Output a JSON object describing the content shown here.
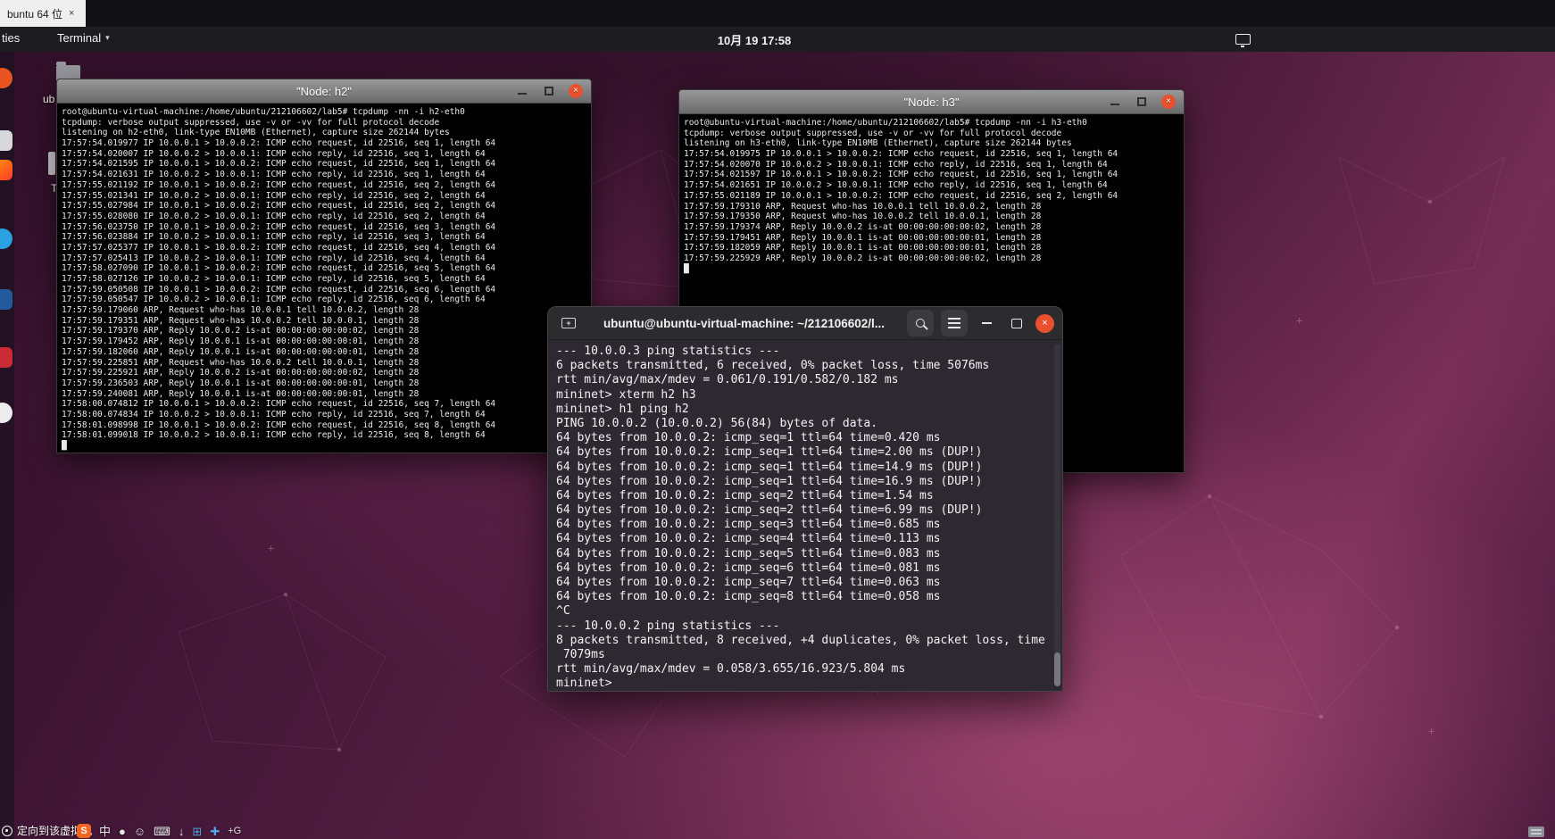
{
  "colors": {
    "accent-close": "#e8502f",
    "sogou-orange": "#f26522",
    "gterm-bg": "#2e2830",
    "ubuntu-orange": "#e95420"
  },
  "icons": {
    "close_x": "×",
    "caret_down": "▾",
    "plus": "+"
  },
  "vmware": {
    "tab_title": "buntu 64 位",
    "statusbar_hint": "定向到该虚拟机"
  },
  "topbar": {
    "activities_fragment": "ties",
    "app_menu": "Terminal",
    "clock": "10月 19 17:58"
  },
  "desktop": {
    "icon_label_fragment_1": "ub",
    "icon_label_fragment_2": "T"
  },
  "h2": {
    "title": "\"Node: h2\"",
    "lines": [
      "root@ubuntu-virtual-machine:/home/ubuntu/212106602/lab5# tcpdump -nn -i h2-eth0",
      "tcpdump: verbose output suppressed, use -v or -vv for full protocol decode",
      "listening on h2-eth0, link-type EN10MB (Ethernet), capture size 262144 bytes",
      "17:57:54.019977 IP 10.0.0.1 > 10.0.0.2: ICMP echo request, id 22516, seq 1, length 64",
      "17:57:54.020007 IP 10.0.0.2 > 10.0.0.1: ICMP echo reply, id 22516, seq 1, length 64",
      "17:57:54.021595 IP 10.0.0.1 > 10.0.0.2: ICMP echo request, id 22516, seq 1, length 64",
      "17:57:54.021631 IP 10.0.0.2 > 10.0.0.1: ICMP echo reply, id 22516, seq 1, length 64",
      "17:57:55.021192 IP 10.0.0.1 > 10.0.0.2: ICMP echo request, id 22516, seq 2, length 64",
      "17:57:55.021341 IP 10.0.0.2 > 10.0.0.1: ICMP echo reply, id 22516, seq 2, length 64",
      "17:57:55.027984 IP 10.0.0.1 > 10.0.0.2: ICMP echo request, id 22516, seq 2, length 64",
      "17:57:55.028080 IP 10.0.0.2 > 10.0.0.1: ICMP echo reply, id 22516, seq 2, length 64",
      "17:57:56.023750 IP 10.0.0.1 > 10.0.0.2: ICMP echo request, id 22516, seq 3, length 64",
      "17:57:56.023884 IP 10.0.0.2 > 10.0.0.1: ICMP echo reply, id 22516, seq 3, length 64",
      "17:57:57.025377 IP 10.0.0.1 > 10.0.0.2: ICMP echo request, id 22516, seq 4, length 64",
      "17:57:57.025413 IP 10.0.0.2 > 10.0.0.1: ICMP echo reply, id 22516, seq 4, length 64",
      "17:57:58.027090 IP 10.0.0.1 > 10.0.0.2: ICMP echo request, id 22516, seq 5, length 64",
      "17:57:58.027126 IP 10.0.0.2 > 10.0.0.1: ICMP echo reply, id 22516, seq 5, length 64",
      "17:57:59.050508 IP 10.0.0.1 > 10.0.0.2: ICMP echo request, id 22516, seq 6, length 64",
      "17:57:59.050547 IP 10.0.0.2 > 10.0.0.1: ICMP echo reply, id 22516, seq 6, length 64",
      "17:57:59.179060 ARP, Request who-has 10.0.0.1 tell 10.0.0.2, length 28",
      "17:57:59.179351 ARP, Request who-has 10.0.0.2 tell 10.0.0.1, length 28",
      "17:57:59.179370 ARP, Reply 10.0.0.2 is-at 00:00:00:00:00:02, length 28",
      "17:57:59.179452 ARP, Reply 10.0.0.1 is-at 00:00:00:00:00:01, length 28",
      "17:57:59.182060 ARP, Reply 10.0.0.1 is-at 00:00:00:00:00:01, length 28",
      "17:57:59.225851 ARP, Request who-has 10.0.0.2 tell 10.0.0.1, length 28",
      "17:57:59.225921 ARP, Reply 10.0.0.2 is-at 00:00:00:00:00:02, length 28",
      "17:57:59.236503 ARP, Reply 10.0.0.1 is-at 00:00:00:00:00:01, length 28",
      "17:57:59.240081 ARP, Reply 10.0.0.1 is-at 00:00:00:00:00:01, length 28",
      "17:58:00.074812 IP 10.0.0.1 > 10.0.0.2: ICMP echo request, id 22516, seq 7, length 64",
      "17:58:00.074834 IP 10.0.0.2 > 10.0.0.1: ICMP echo reply, id 22516, seq 7, length 64",
      "17:58:01.098998 IP 10.0.0.1 > 10.0.0.2: ICMP echo request, id 22516, seq 8, length 64",
      "17:58:01.099018 IP 10.0.0.2 > 10.0.0.1: ICMP echo reply, id 22516, seq 8, length 64",
      "█"
    ]
  },
  "h3": {
    "title": "\"Node: h3\"",
    "lines": [
      "root@ubuntu-virtual-machine:/home/ubuntu/212106602/lab5# tcpdump -nn -i h3-eth0",
      "tcpdump: verbose output suppressed, use -v or -vv for full protocol decode",
      "listening on h3-eth0, link-type EN10MB (Ethernet), capture size 262144 bytes",
      "17:57:54.019975 IP 10.0.0.1 > 10.0.0.2: ICMP echo request, id 22516, seq 1, length 64",
      "17:57:54.020070 IP 10.0.0.2 > 10.0.0.1: ICMP echo reply, id 22516, seq 1, length 64",
      "17:57:54.021597 IP 10.0.0.1 > 10.0.0.2: ICMP echo request, id 22516, seq 1, length 64",
      "17:57:54.021651 IP 10.0.0.2 > 10.0.0.1: ICMP echo reply, id 22516, seq 1, length 64",
      "17:57:55.021189 IP 10.0.0.1 > 10.0.0.2: ICMP echo request, id 22516, seq 2, length 64",
      "17:57:59.179310 ARP, Request who-has 10.0.0.1 tell 10.0.0.2, length 28",
      "17:57:59.179350 ARP, Request who-has 10.0.0.2 tell 10.0.0.1, length 28",
      "17:57:59.179374 ARP, Reply 10.0.0.2 is-at 00:00:00:00:00:02, length 28",
      "17:57:59.179451 ARP, Reply 10.0.0.1 is-at 00:00:00:00:00:01, length 28",
      "17:57:59.182059 ARP, Reply 10.0.0.1 is-at 00:00:00:00:00:01, length 28",
      "17:57:59.225929 ARP, Reply 10.0.0.2 is-at 00:00:00:00:00:02, length 28",
      "█"
    ]
  },
  "terminal": {
    "title": "ubuntu@ubuntu-virtual-machine: ~/212106602/l...",
    "lines": [
      "--- 10.0.0.3 ping statistics ---",
      "6 packets transmitted, 6 received, 0% packet loss, time 5076ms",
      "rtt min/avg/max/mdev = 0.061/0.191/0.582/0.182 ms",
      "mininet> xterm h2 h3",
      "mininet> h1 ping h2",
      "PING 10.0.0.2 (10.0.0.2) 56(84) bytes of data.",
      "64 bytes from 10.0.0.2: icmp_seq=1 ttl=64 time=0.420 ms",
      "64 bytes from 10.0.0.2: icmp_seq=1 ttl=64 time=2.00 ms (DUP!)",
      "64 bytes from 10.0.0.2: icmp_seq=1 ttl=64 time=14.9 ms (DUP!)",
      "64 bytes from 10.0.0.2: icmp_seq=1 ttl=64 time=16.9 ms (DUP!)",
      "64 bytes from 10.0.0.2: icmp_seq=2 ttl=64 time=1.54 ms",
      "64 bytes from 10.0.0.2: icmp_seq=2 ttl=64 time=6.99 ms (DUP!)",
      "64 bytes from 10.0.0.2: icmp_seq=3 ttl=64 time=0.685 ms",
      "64 bytes from 10.0.0.2: icmp_seq=4 ttl=64 time=0.113 ms",
      "64 bytes from 10.0.0.2: icmp_seq=5 ttl=64 time=0.083 ms",
      "64 bytes from 10.0.0.2: icmp_seq=6 ttl=64 time=0.081 ms",
      "64 bytes from 10.0.0.2: icmp_seq=7 ttl=64 time=0.063 ms",
      "64 bytes from 10.0.0.2: icmp_seq=8 ttl=64 time=0.058 ms",
      "^C",
      "--- 10.0.0.2 ping statistics ---",
      "8 packets transmitted, 8 received, +4 duplicates, 0% packet loss, time",
      " 7079ms",
      "rtt min/avg/max/mdev = 0.058/3.655/16.923/5.804 ms",
      "mininet> "
    ]
  },
  "ime": {
    "logo": "S",
    "lang": "中",
    "icon_dot": "●",
    "icon_smiley": "☺",
    "icon_keyboard": "⌨",
    "icon_download": "↓",
    "icon_grid": "⊞",
    "icon_plus": "✚",
    "suffix": "+G"
  }
}
